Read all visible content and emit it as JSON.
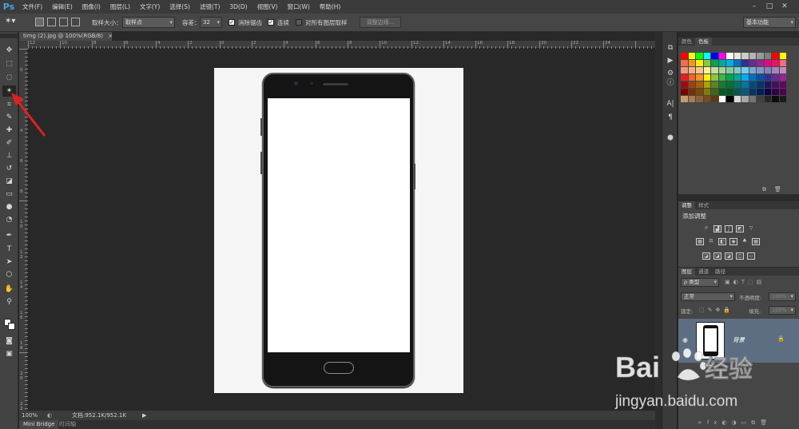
{
  "app": {
    "logo": "Ps"
  },
  "menu": [
    "文件(F)",
    "编辑(E)",
    "图像(I)",
    "图层(L)",
    "文字(Y)",
    "选择(S)",
    "滤镜(T)",
    "3D(D)",
    "视图(V)",
    "窗口(W)",
    "帮助(H)"
  ],
  "window_controls": {
    "minimize": "–",
    "restore": "□",
    "close": "✕"
  },
  "options": {
    "sample_size_label": "取样大小：",
    "sample_size_value": "取样点",
    "tolerance_label": "容差：",
    "tolerance_value": "32",
    "antialias_label": "消除锯齿",
    "antialias_checked": "✓",
    "contiguous_label": "连续",
    "contiguous_checked": "✓",
    "all_layers_label": "对所有图层取样",
    "refine_edge_button": "调整边缘...",
    "workspace_value": "基本功能"
  },
  "document_tab": {
    "title": "timg (2).jpg @ 100%(RGB/8)",
    "close": "×"
  },
  "ruler": {
    "top_ticks": [
      "12",
      "10",
      "8",
      "6",
      "4",
      "2",
      "0",
      "2",
      "4",
      "6",
      "8",
      "10",
      "12",
      "14",
      "16",
      "18",
      "20",
      "22",
      "24"
    ],
    "left_ticks": [
      "0",
      "2",
      "4",
      "6",
      "8",
      "1 0",
      "1 2",
      "1 4",
      "1 6",
      "1 8",
      "2 0",
      "2 2"
    ]
  },
  "status": {
    "zoom": "100%",
    "doc_info": "文档:952.1K/952.1K",
    "arrow": "▶"
  },
  "bottom_tabs": {
    "mini_bridge": "Mini Bridge",
    "timeline": "时间轴"
  },
  "panels": {
    "color": {
      "tab_swatches": "颜色",
      "tab_color": "色板"
    },
    "adjustments": {
      "tab_adjust": "调整",
      "tab_style": "样式",
      "title": "添加调整"
    },
    "layers": {
      "tab_layers": "图层",
      "tab_channels": "通道",
      "tab_paths": "路径",
      "filter_kind": "ρ 类型",
      "blend_mode": "正常",
      "opacity_label": "不透明度:",
      "opacity_value": "100%",
      "lock_label": "锁定:",
      "fill_label": "填充:",
      "fill_value": "100%",
      "layer_name": "背景",
      "lock_icon": "🔒"
    }
  },
  "swatch_colors": [
    "#ff0000",
    "#ffff00",
    "#00ff00",
    "#00ffff",
    "#0000ff",
    "#ff00ff",
    "#ffffff",
    "#e6e6e6",
    "#cccccc",
    "#b3b3b3",
    "#999999",
    "#808080",
    "#ff0000",
    "#ffff00",
    "#f26c4f",
    "#f7941d",
    "#fff200",
    "#8dc63f",
    "#00a651",
    "#00a99d",
    "#00aeef",
    "#0072bc",
    "#2e3192",
    "#662d91",
    "#92278f",
    "#ec008c",
    "#ed145b",
    "#f26d7d",
    "#f7977a",
    "#fbad82",
    "#fdc68c",
    "#fff799",
    "#c4df9b",
    "#a3d39c",
    "#82ca9c",
    "#7accc8",
    "#6dcff6",
    "#7da7d9",
    "#8393ca",
    "#8781bd",
    "#a186be",
    "#bd8cbf",
    "#ed1c24",
    "#f26522",
    "#f7941d",
    "#fff200",
    "#8dc63f",
    "#39b54a",
    "#00a651",
    "#00a99d",
    "#00aeef",
    "#0072bc",
    "#0054a6",
    "#2e3192",
    "#662d91",
    "#92278f",
    "#9e0b0f",
    "#a0410d",
    "#a36209",
    "#aba000",
    "#598527",
    "#197b30",
    "#007236",
    "#00746b",
    "#0076a3",
    "#004a80",
    "#003471",
    "#1b1464",
    "#440e62",
    "#630460",
    "#790000",
    "#7b2e00",
    "#7d4900",
    "#827b00",
    "#406618",
    "#005e20",
    "#005826",
    "#005952",
    "#005b7f",
    "#003663",
    "#002157",
    "#0d004c",
    "#32004b",
    "#4b0049",
    "#c69c6d",
    "#a67c52",
    "#8c6239",
    "#754c24",
    "#603913",
    "#ffffff",
    "#000000",
    "#d9d9d9",
    "#a6a6a6",
    "#737373",
    "#404040",
    "#262626",
    "#0d0d0d",
    "#1a1a1a"
  ],
  "colors": {
    "accent_layer_row": "#5e6e82",
    "arrow_red": "#e02020"
  },
  "watermark": {
    "brand": "Bai",
    "paw": "du",
    "suffix": "经验",
    "url": "jingyan.baidu.com"
  }
}
